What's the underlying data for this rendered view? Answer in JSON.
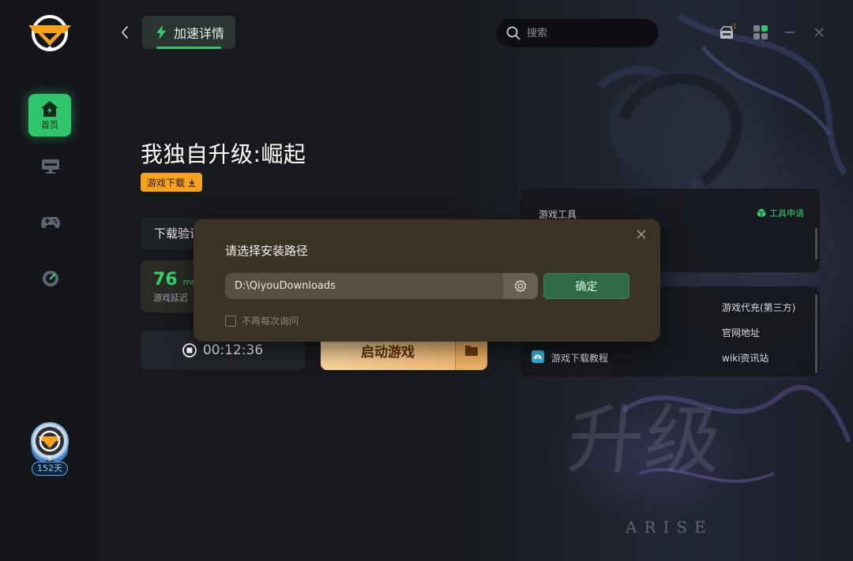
{
  "nav": {
    "home_label": "首页",
    "items": [
      {
        "name": "monitor-icon"
      },
      {
        "name": "gamepad-icon"
      },
      {
        "name": "speed-gauge-icon"
      }
    ],
    "days_badge": "152天",
    "avatar_level": "5"
  },
  "header": {
    "tab_label": "加速详情",
    "search_placeholder": "搜索",
    "gift_badge": "+1"
  },
  "game": {
    "title": "我独自升级:崛起",
    "download_label": "游戏下载",
    "verify_label": "下载验证",
    "latency_value": "76",
    "latency_unit": "ms",
    "latency_label": "游戏延迟",
    "timer": "00:12:36",
    "start_label": "启动游戏"
  },
  "tools": {
    "header": "游戏工具",
    "apply_label": "工具申请"
  },
  "links": {
    "recharge": "游戏代充(第三方)",
    "official": "官网地址",
    "tutorial": "游戏下载教程",
    "wiki": "wiki资讯站"
  },
  "modal": {
    "title": "请选择安装路径",
    "path_value": "D:\\QiyouDownloads",
    "confirm_label": "确定",
    "dont_ask_label": "不再每次询问"
  },
  "art": {
    "calligraphy": "升级",
    "subtitle": "ARISE"
  },
  "colors": {
    "accent_green": "#2fc56a",
    "orange": "#f7a21b",
    "modal_bg": "#3b3426"
  }
}
